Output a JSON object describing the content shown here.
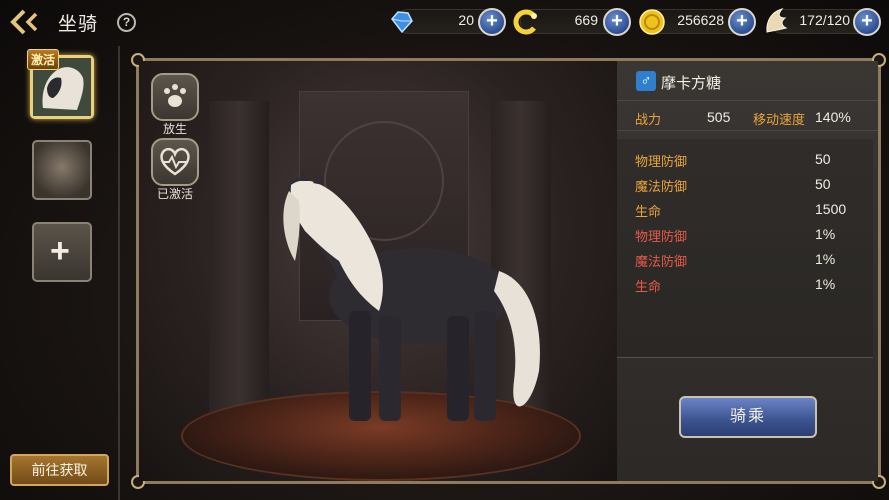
{
  "header": {
    "title": "坐骑"
  },
  "resources": [
    {
      "icon": "blue-gem-icon",
      "value": "20"
    },
    {
      "icon": "gold-c-coin-icon",
      "value": "669"
    },
    {
      "icon": "gold-coin-icon",
      "value": "256628"
    },
    {
      "icon": "wing-energy-icon",
      "value": "172/120"
    }
  ],
  "sidebar": {
    "active_badge": "激活",
    "add_symbol": "+",
    "goto_button": "前往获取"
  },
  "actions": [
    {
      "icon": "paw-icon",
      "label": "放生"
    },
    {
      "icon": "heart-pulse-icon",
      "label": "已激活"
    }
  ],
  "mount": {
    "gender_symbol": "♂",
    "name": "摩卡方糖",
    "power_label": "战力",
    "power_value": "505",
    "speed_label": "移动速度",
    "speed_value": "140%"
  },
  "stats": [
    {
      "label": "物理防御",
      "value": "50",
      "color": "gold"
    },
    {
      "label": "魔法防御",
      "value": "50",
      "color": "gold"
    },
    {
      "label": "生命",
      "value": "1500",
      "color": "gold"
    },
    {
      "label": "物理防御",
      "value": "1%",
      "color": "red"
    },
    {
      "label": "魔法防御",
      "value": "1%",
      "color": "red"
    },
    {
      "label": "生命",
      "value": "1%",
      "color": "red"
    }
  ],
  "ride_button": "骑乘",
  "colors": {
    "accent_gold": "#e9a53c",
    "accent_red": "#e65a48",
    "button_blue": "#3b528f"
  }
}
